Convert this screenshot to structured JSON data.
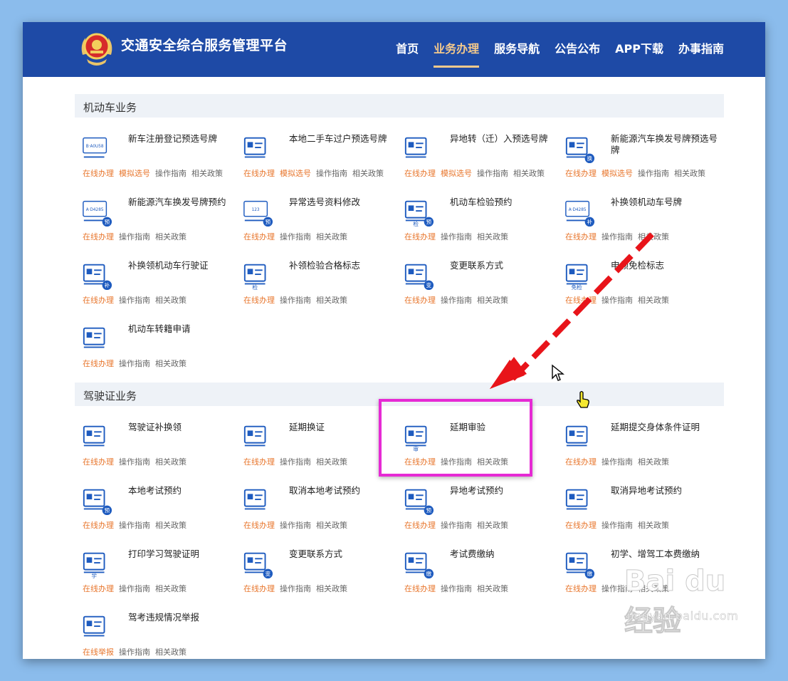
{
  "header": {
    "title": "交通安全综合服务管理平台",
    "nav": [
      "首页",
      "业务办理",
      "服务导航",
      "公告公布",
      "APP下载",
      "办事指南"
    ],
    "active_nav": "业务办理"
  },
  "sections": [
    {
      "title": "机动车业务",
      "items": [
        {
          "title": "新车注册登记预选号牌",
          "icon": "new-car-plate-icon",
          "links": [
            "在线办理",
            "模拟选号",
            "操作指南",
            "相关政策"
          ],
          "plate_text": "B·A0U58"
        },
        {
          "title": "本地二手车过户预选号牌",
          "icon": "used-car-transfer-icon",
          "links": [
            "在线办理",
            "模拟选号",
            "操作指南",
            "相关政策"
          ]
        },
        {
          "title": "异地转（迁）入预选号牌",
          "icon": "car-migrate-in-icon",
          "links": [
            "在线办理",
            "模拟选号",
            "操作指南",
            "相关政策"
          ]
        },
        {
          "title": "新能源汽车换发号牌预选号牌",
          "icon": "ev-car-exchange-icon",
          "links": [
            "在线办理",
            "模拟选号",
            "操作指南",
            "相关政策"
          ],
          "badge": "换"
        },
        {
          "title": "新能源汽车换发号牌预约",
          "icon": "ev-plate-reserve-icon",
          "links": [
            "在线办理",
            "操作指南",
            "相关政策"
          ],
          "badge": "预",
          "plate_text": "A·D4285"
        },
        {
          "title": "异常选号资料修改",
          "icon": "number-edit-icon",
          "links": [
            "在线办理",
            "操作指南",
            "相关政策"
          ],
          "badge": "预",
          "plate_text": "123"
        },
        {
          "title": "机动车检验预约",
          "icon": "inspection-reserve-icon",
          "links": [
            "在线办理",
            "操作指南",
            "相关政策"
          ],
          "badge": "预",
          "doc_text": "检"
        },
        {
          "title": "补换领机动车号牌",
          "icon": "plate-replace-icon",
          "links": [
            "在线办理",
            "操作指南",
            "相关政策"
          ],
          "badge": "补",
          "plate_text": "A·D4285"
        },
        {
          "title": "补换领机动车行驶证",
          "icon": "license-replace-icon",
          "links": [
            "在线办理",
            "操作指南",
            "相关政策"
          ],
          "badge": "补"
        },
        {
          "title": "补领检验合格标志",
          "icon": "inspection-mark-icon",
          "links": [
            "在线办理",
            "操作指南",
            "相关政策"
          ],
          "doc_text": "检"
        },
        {
          "title": "变更联系方式",
          "icon": "contact-change-icon",
          "links": [
            "在线办理",
            "操作指南",
            "相关政策"
          ],
          "badge": "变"
        },
        {
          "title": "申领免检标志",
          "icon": "exempt-mark-icon",
          "links": [
            "在线办理",
            "操作指南",
            "相关政策"
          ],
          "doc_text": "免检"
        },
        {
          "title": "机动车转籍申请",
          "icon": "car-transfer-icon",
          "links": [
            "在线办理",
            "操作指南",
            "相关政策"
          ]
        }
      ]
    },
    {
      "title": "驾驶证业务",
      "items": [
        {
          "title": "驾驶证补换领",
          "icon": "driver-license-replace-icon",
          "links": [
            "在线办理",
            "操作指南",
            "相关政策"
          ]
        },
        {
          "title": "延期换证",
          "icon": "extend-license-icon",
          "links": [
            "在线办理",
            "操作指南",
            "相关政策"
          ]
        },
        {
          "title": "延期审验",
          "icon": "extend-review-icon",
          "links": [
            "在线办理",
            "操作指南",
            "相关政策"
          ],
          "doc_text": "审"
        },
        {
          "title": "延期提交身体条件证明",
          "icon": "health-proof-icon",
          "links": [
            "在线办理",
            "操作指南",
            "相关政策"
          ]
        },
        {
          "title": "本地考试预约",
          "icon": "local-exam-icon",
          "links": [
            "在线办理",
            "操作指南",
            "相关政策"
          ],
          "badge": "预"
        },
        {
          "title": "取消本地考试预约",
          "icon": "cancel-local-exam-icon",
          "links": [
            "在线办理",
            "操作指南",
            "相关政策"
          ]
        },
        {
          "title": "异地考试预约",
          "icon": "remote-exam-icon",
          "links": [
            "在线办理",
            "操作指南",
            "相关政策"
          ],
          "badge": "预"
        },
        {
          "title": "取消异地考试预约",
          "icon": "cancel-remote-exam-icon",
          "links": [
            "在线办理",
            "操作指南",
            "相关政策"
          ]
        },
        {
          "title": "打印学习驾驶证明",
          "icon": "print-learner-icon",
          "links": [
            "在线办理",
            "操作指南",
            "相关政策"
          ],
          "doc_text": "学"
        },
        {
          "title": "变更联系方式",
          "icon": "contact-change-icon",
          "links": [
            "在线办理",
            "操作指南",
            "相关政策"
          ],
          "badge": "变"
        },
        {
          "title": "考试费缴纳",
          "icon": "exam-fee-icon",
          "links": [
            "在线办理",
            "操作指南",
            "相关政策"
          ],
          "badge": "缴"
        },
        {
          "title": "初学、增驾工本费缴纳",
          "icon": "fee-pay-icon",
          "links": [
            "在线办理",
            "操作指南",
            "相关政策"
          ],
          "badge": "缴"
        },
        {
          "title": "驾考违规情况举报",
          "icon": "violation-report-icon",
          "links": [
            "在线举报",
            "操作指南",
            "相关政策"
          ]
        }
      ]
    }
  ],
  "watermark": {
    "logo": "Bai du 经验",
    "url": "jingyan.baidu.com"
  },
  "colors": {
    "header": "#1e4aa6",
    "link_highlight": "#e8772e",
    "frame_highlight": "#e62ad4",
    "arrow": "#e8141a",
    "icon": "#1e5bbf"
  }
}
